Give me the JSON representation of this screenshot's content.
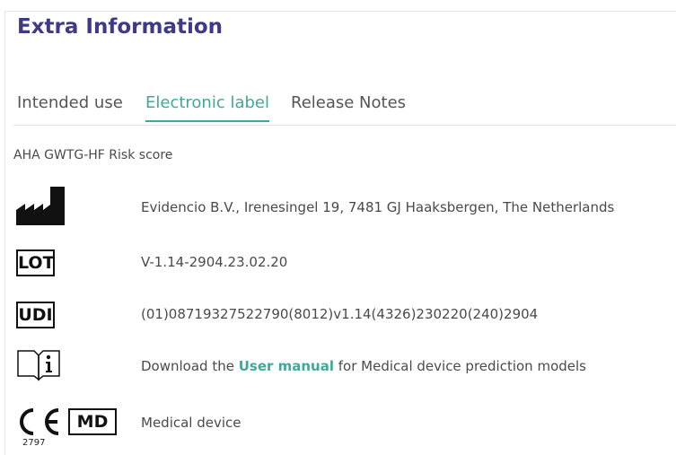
{
  "title": "Extra Information",
  "tabs": [
    {
      "label": "Intended use",
      "active": false
    },
    {
      "label": "Electronic label",
      "active": true
    },
    {
      "label": "Release Notes",
      "active": false
    }
  ],
  "model_name": "AHA GWTG-HF Risk score",
  "rows": {
    "manufacturer": {
      "text": "Evidencio B.V., Irenesingel 19, 7481 GJ Haaksbergen, The Netherlands"
    },
    "lot": {
      "symbol": "LOT",
      "text": "V-1.14-2904.23.02.20"
    },
    "udi": {
      "symbol": "UDI",
      "text": "(01)08719327522790(8012)v1.14(4326)230220(240)2904"
    },
    "manual": {
      "prefix": "Download the ",
      "link": "User manual",
      "suffix": " for Medical device prediction models"
    },
    "device": {
      "symbol": "MD",
      "ce_number": "2797",
      "text": "Medical device"
    }
  },
  "colors": {
    "title": "#3e3a86",
    "accent": "#3daa98",
    "text": "#4a4a4a"
  }
}
